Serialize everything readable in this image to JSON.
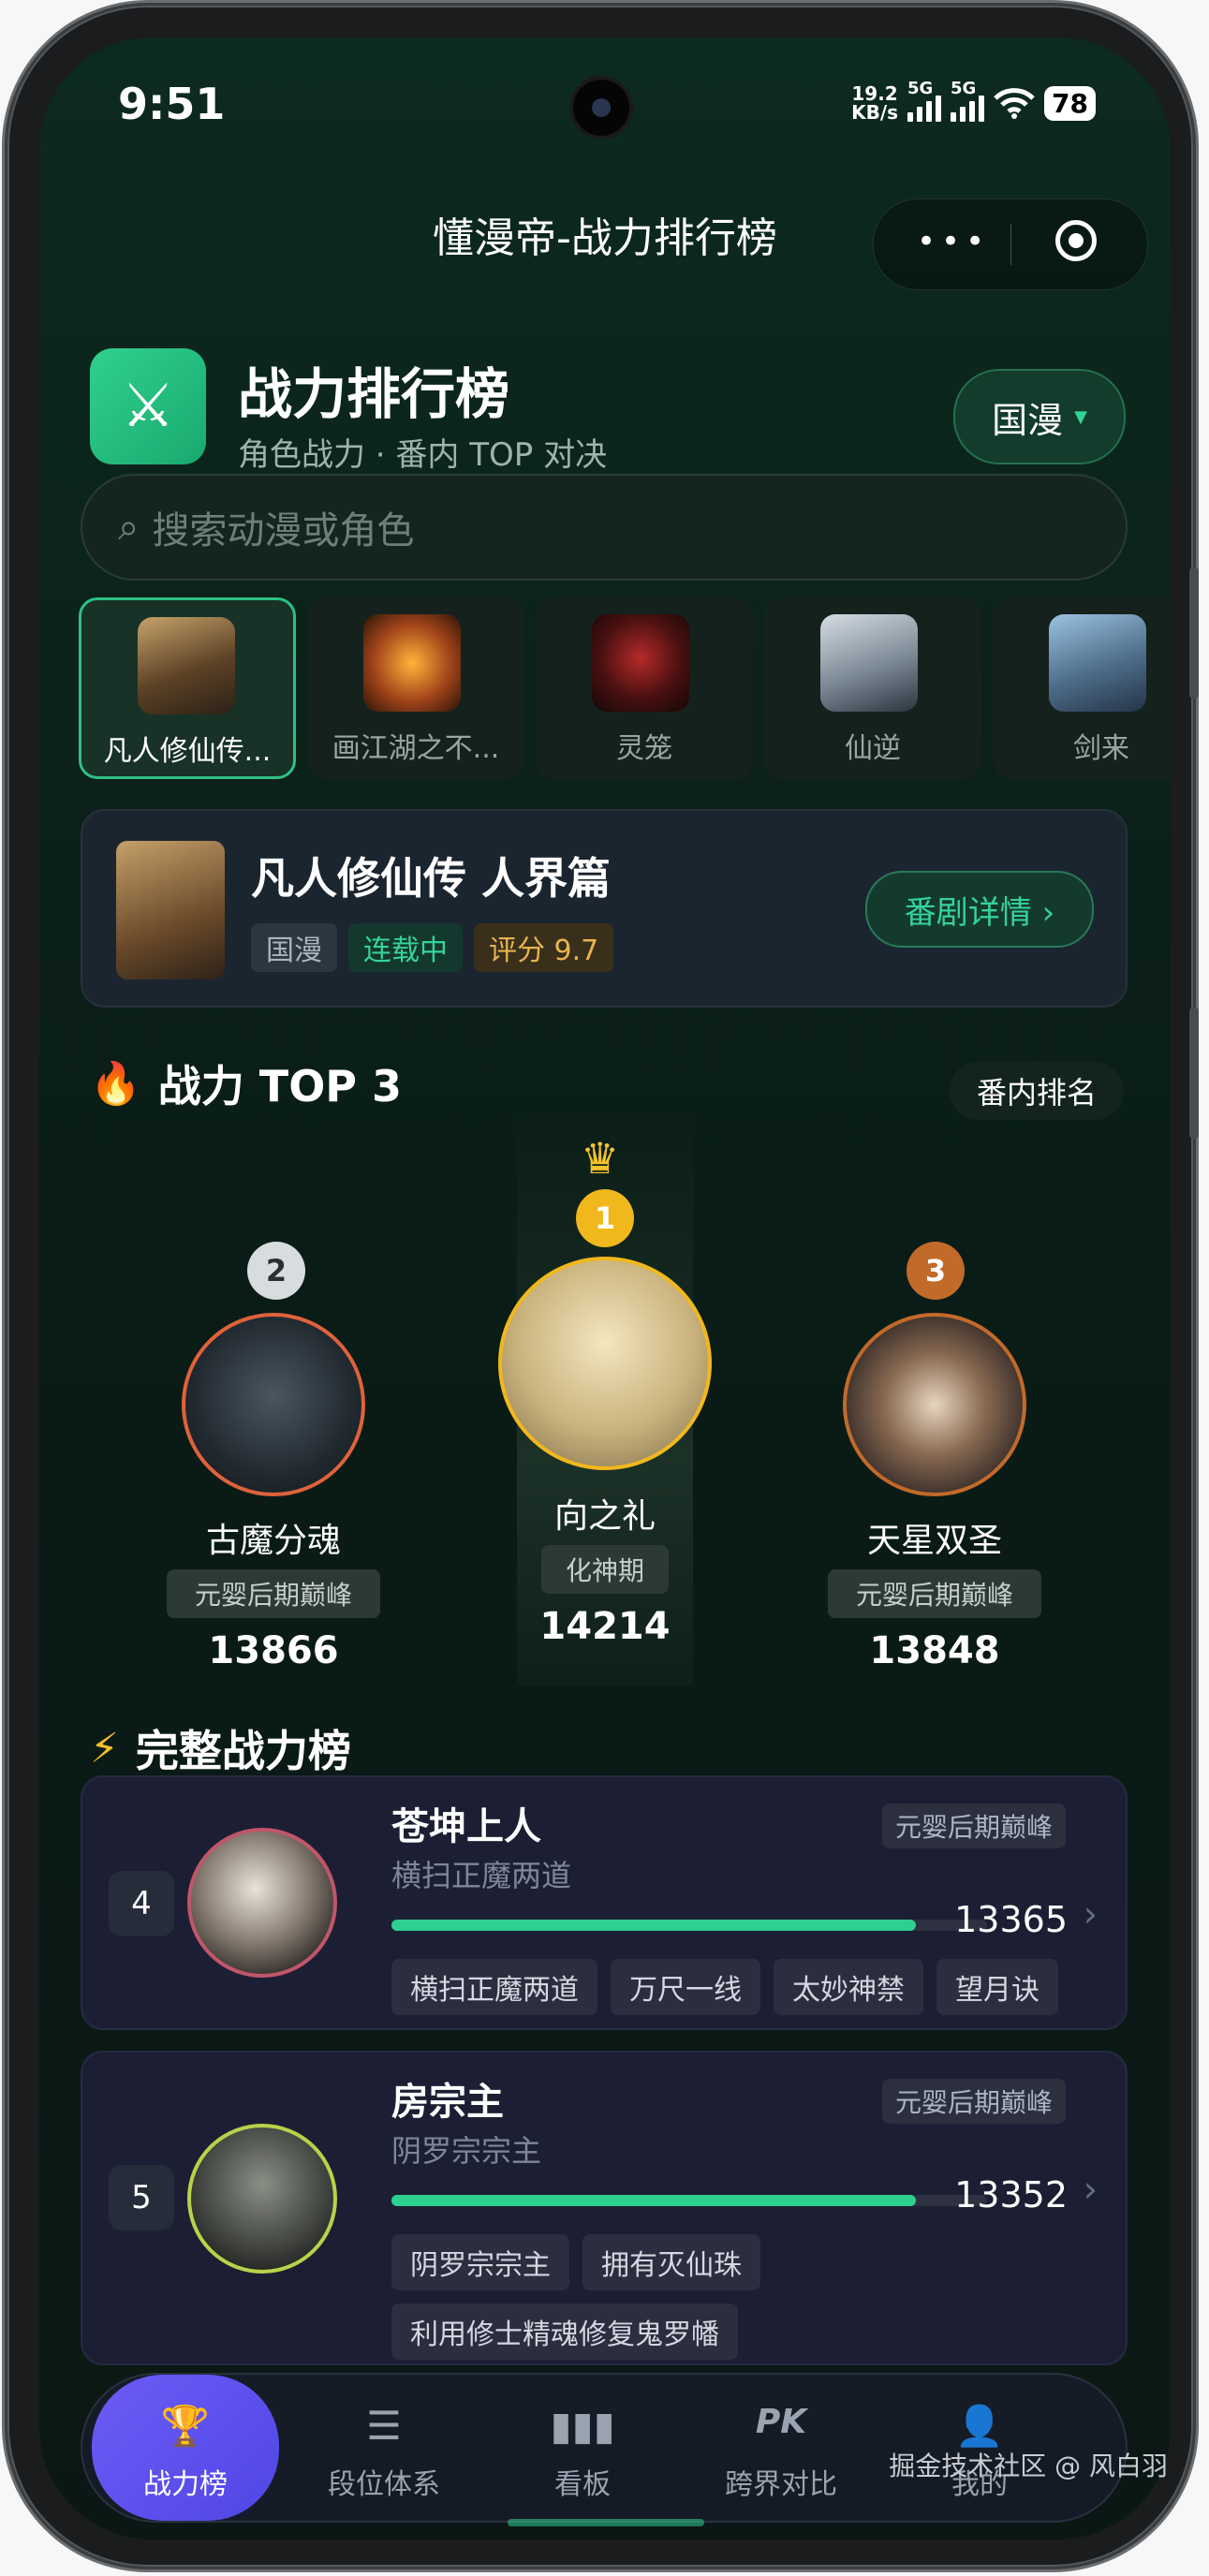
{
  "status_bar": {
    "time": "9:51",
    "net_speed": "19.2",
    "net_unit": "KB/s",
    "sig1": "5G",
    "sig2": "5G",
    "battery": "78"
  },
  "titlebar": {
    "title": "懂漫帝-战力排行榜"
  },
  "header": {
    "title": "战力排行榜",
    "subtitle": "角色战力 · 番内 TOP 对决",
    "region": "国漫",
    "logo_icon": "crossed-swords-icon"
  },
  "search": {
    "placeholder": "搜索动漫或角色"
  },
  "anime_tabs": [
    {
      "name": "凡人修仙传...",
      "active": true
    },
    {
      "name": "画江湖之不...",
      "active": false
    },
    {
      "name": "灵笼",
      "active": false
    },
    {
      "name": "仙逆",
      "active": false
    },
    {
      "name": "剑来",
      "active": false
    }
  ],
  "drama": {
    "title": "凡人修仙传 人界篇",
    "tags": [
      "国漫",
      "连载中",
      "评分 9.7"
    ],
    "detail_button": "番剧详情 ›"
  },
  "top3": {
    "section_title": "战力 TOP 3",
    "rank_button": "番内排名",
    "first": {
      "rank": "1",
      "name": "向之礼",
      "realm": "化神期",
      "power": "14214"
    },
    "second": {
      "rank": "2",
      "name": "古魔分魂",
      "realm": "元婴后期巅峰",
      "power": "13866"
    },
    "third": {
      "rank": "3",
      "name": "天星双圣",
      "realm": "元婴后期巅峰",
      "power": "13848"
    }
  },
  "full_rank": {
    "section_title": "完整战力榜",
    "items": [
      {
        "rank": "4",
        "name": "苍坤上人",
        "subtitle": "横扫正魔两道",
        "realm": "元婴后期巅峰",
        "power": "13365",
        "progress": 0.88,
        "skills": [
          "横扫正魔两道",
          "万尺一线",
          "太妙神禁",
          "望月诀"
        ]
      },
      {
        "rank": "5",
        "name": "房宗主",
        "subtitle": "阴罗宗宗主",
        "realm": "元婴后期巅峰",
        "power": "13352",
        "progress": 0.88,
        "skills": [
          "阴罗宗宗主",
          "拥有灭仙珠",
          "利用修士精魂修复鬼罗幡"
        ]
      }
    ]
  },
  "bottom_tabs": [
    {
      "label": "战力榜",
      "icon": "trophy-icon",
      "active": true
    },
    {
      "label": "段位体系",
      "icon": "list-icon",
      "active": false
    },
    {
      "label": "看板",
      "icon": "bar-chart-icon",
      "active": false
    },
    {
      "label": "跨界对比",
      "icon": "pk-icon",
      "active": false
    },
    {
      "label": "我的",
      "icon": "user-icon",
      "active": false
    }
  ],
  "watermark": "掘金技术社区 @ 风白羽",
  "colors": {
    "accent": "#2dd08f",
    "tab_active": "#5b50f0",
    "gold": "#f1b81d",
    "bronze": "#c26a2a"
  }
}
